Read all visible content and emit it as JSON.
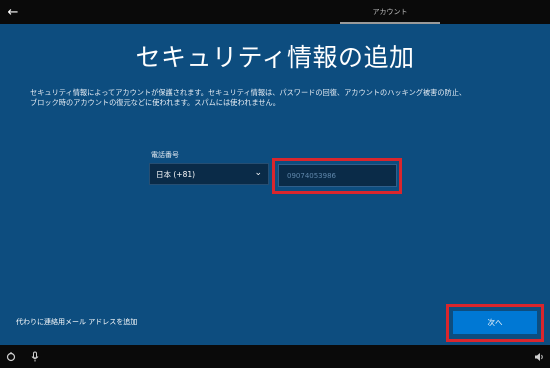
{
  "header": {
    "back_icon": "back-arrow-icon",
    "tab_label": "アカウント"
  },
  "main": {
    "title": "セキュリティ情報の追加",
    "description_line1": "セキュリティ情報によってアカウントが保護されます。セキュリティ情報は、パスワードの回復、アカウントのハッキング被害の防止、",
    "description_line2": "ブロック時のアカウントの復元などに使われます。スパムには使われません。",
    "phone_label": "電話番号",
    "country_value": "日本 (+81)",
    "phone_value": "09074053986",
    "alt_link": "代わりに連絡用メール アドレスを追加",
    "next_label": "次へ"
  },
  "taskbar": {
    "left_icons": [
      "ease-of-access-icon",
      "microphone-icon"
    ],
    "right_icons": [
      "volume-icon"
    ]
  },
  "colors": {
    "background": "#0d4d7f",
    "accent": "#0078d4",
    "highlight": "#d9262d"
  }
}
